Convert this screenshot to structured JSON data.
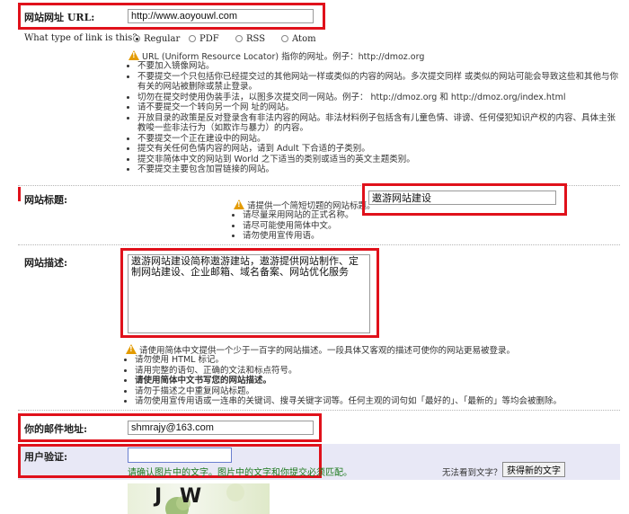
{
  "url_section": {
    "label": "网站网址 URL:",
    "value": "http://www.aoyouwl.com",
    "link_type_question": "What type of link is this?",
    "options": [
      "Regular",
      "PDF",
      "RSS",
      "Atom"
    ],
    "note": "URL (Uniform Resource Locator) 指你的网址。例子：http://dmoz.org",
    "bullets": [
      "不要加入镜像网站。",
      "不要提交一个只包括你已经提交过的其他网站一样或类似的内容的网站。多次提交同样 或类似的网站可能会导致这些和其他与你有关的网站被删除或禁止登录。",
      "切勿在提交时使用伪装手法，以图多次提交同一网站。例子： http://dmoz.org 和 http://dmoz.org/index.html",
      "请不要提交一个转向另一个网 址的网站。",
      "开放目录的政策是反对登录含有非法内容的网站。非法材料例子包括含有儿童色情、诽谤、任何侵犯知识产权的内容、具体主张教唆一些非法行为（如欺诈与暴力）的内容。",
      "不要提交一个正在建设中的网站。",
      "提交有关任何色情内容的网站，请到 Adult 下合适的子类别。",
      "提交非简体中文的网站到 World 之下适当的类别或适当的英文主题类别。",
      "不要提交主要包含加冒链接的网站。"
    ]
  },
  "title_section": {
    "label": "网站标题:",
    "value": "遨游网站建设",
    "note": "请提供一个简短切题的网站标题。",
    "bullets": [
      "请尽量采用网站的正式名称。",
      "请尽可能使用简体中文。",
      "请勿使用宣传用语。"
    ]
  },
  "desc_section": {
    "label": "网站描述:",
    "value": "遨游网站建设简称遨游建站，遨游提供网站制作、定制网站建设、企业邮箱、域名备案、网站优化服务",
    "note": "请使用简体中文提供一个少于一百字的网站描述。一段具体又客观的描述可使你的网站更易被登录。",
    "bullets": [
      "请勿使用 HTML 标记。",
      "请用完整的语句、正确的文法和标点符号。",
      "请使用简体中文书写您的网站描述。",
      "请勿于描述之中重复网站标题。",
      "请勿使用宣传用语或一连串的关键词、搜寻关键字词等。任何主观的词句如「最好的」、「最新的」等均会被删除。"
    ]
  },
  "email_section": {
    "label": "你的邮件地址:",
    "value": "shmrajy@163.com"
  },
  "verify_section": {
    "label": "用户验证:",
    "value": "",
    "hint": "请确认图片中的文字。图片中的文字和你提交必须匹配。",
    "cant_see": "无法看到文字？",
    "new_text_button": "获得新的文字",
    "captcha_text": "J W"
  },
  "colors": {
    "highlight_border": "#e0111b",
    "warning_icon": "#e39b00",
    "verify_bg": "#e8e8f6",
    "hint_green": "#1d7a1d"
  }
}
